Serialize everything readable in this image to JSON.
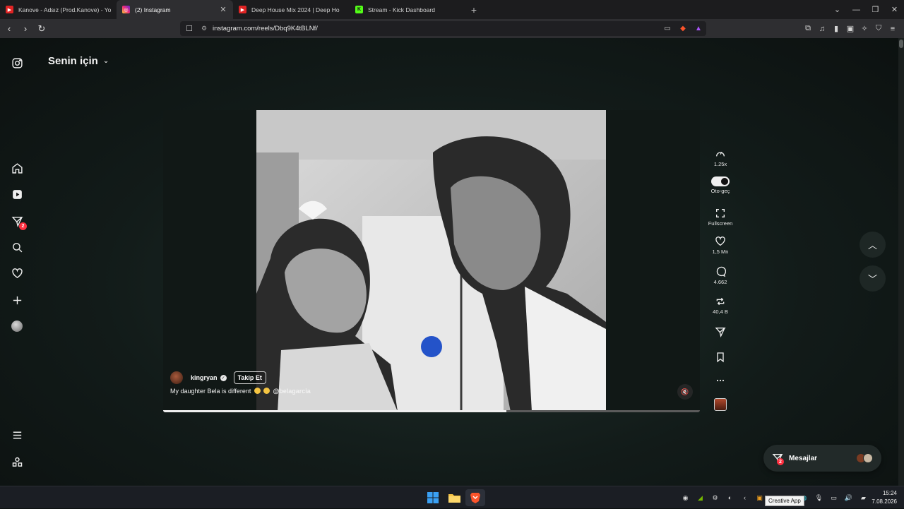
{
  "browser": {
    "tabs": [
      {
        "title": "Kanove - Adsız (Prod.Kanove) - YouTu",
        "favicon": "youtube-icon",
        "color": "#e02424",
        "active": false
      },
      {
        "title": "(2) Instagram",
        "favicon": "instagram-icon",
        "color": "#d6249f",
        "active": true
      },
      {
        "title": "Deep House Mix 2024 | Deep Ho",
        "favicon": "youtube-icon",
        "color": "#e02424",
        "active": false
      },
      {
        "title": "Stream - Kick Dashboard",
        "favicon": "kick-icon",
        "color": "#53fc18",
        "active": false
      }
    ],
    "url": "instagram.com/reels/Dbq9K4tBLNf/"
  },
  "sidebar": {
    "items": [
      "instagram-logo",
      "home",
      "reels",
      "messages",
      "search",
      "notifications",
      "create",
      "profile"
    ],
    "messages_badge": "2"
  },
  "feed": {
    "title": "Senin için"
  },
  "reel": {
    "username": "kingryan",
    "follow_label": "Takip Et",
    "caption_text": "My daughter Bela is different",
    "caption_mention": "@belagarcia",
    "progress": 0.64
  },
  "actions": {
    "speed": "1.25x",
    "autoplay": "Oto-geç",
    "fullscreen": "Fullscreen",
    "likes": "1,5 Mn",
    "comments": "4.662",
    "reposts": "40,4 B"
  },
  "messages_widget": {
    "label": "Mesajlar",
    "badge": "2"
  },
  "taskbar": {
    "time": "15:24",
    "date": "7.08.2026",
    "tooltip": "Creative App"
  }
}
